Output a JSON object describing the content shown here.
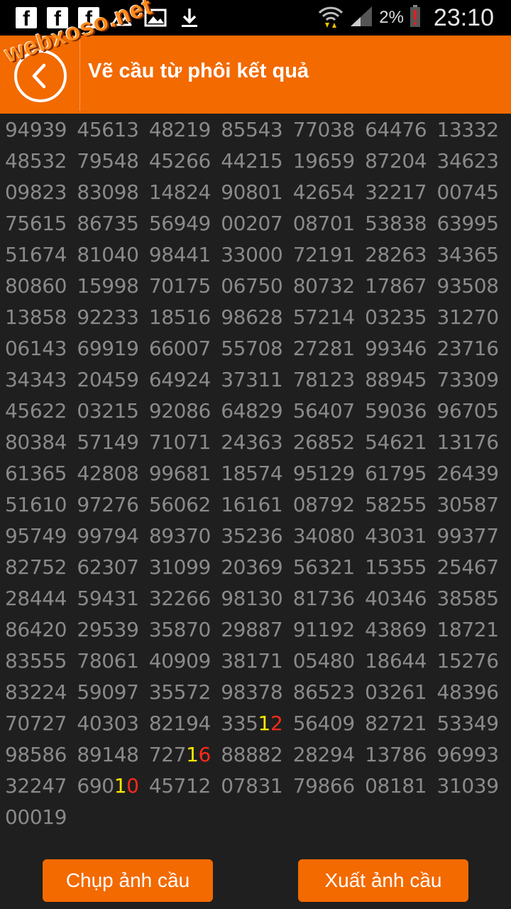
{
  "status_bar": {
    "facebook_glyph": "f",
    "battery_percent": "2%",
    "time": "23:10",
    "icons": [
      "facebook-icon",
      "facebook-icon",
      "facebook-icon",
      "mountain-icon",
      "image-icon",
      "download-icon",
      "wifi-icon",
      "signal-icon",
      "battery-alert-icon"
    ]
  },
  "watermark": "webxoso.net",
  "header": {
    "title": "Vẽ cầu từ phôi kết quả"
  },
  "colors": {
    "accent": "#f26a00",
    "highlight_yellow": "#ffea00",
    "highlight_red": "#ff2a1a",
    "number_gray": "#8a8a8a",
    "background": "#1f1f1f"
  },
  "grid": {
    "rows": [
      [
        "94939",
        "45613",
        "48219",
        "85543",
        "77038",
        "64476",
        "13332"
      ],
      [
        "48532",
        "79548",
        "45266",
        "44215",
        "19659",
        "87204",
        "34623"
      ],
      [
        "09823",
        "83098",
        "14824",
        "90801",
        "42654",
        "32217",
        "00745"
      ],
      [
        "75615",
        "86735",
        "56949",
        "00207",
        "08701",
        "53838",
        "63995"
      ],
      [
        "51674",
        "81040",
        "98441",
        "33000",
        "72191",
        "28263",
        "34365"
      ],
      [
        "80860",
        "15998",
        "70175",
        "06750",
        "80732",
        "17867",
        "93508"
      ],
      [
        "13858",
        "92233",
        "18516",
        "98628",
        "57214",
        "03235",
        "31270"
      ],
      [
        "06143",
        "69919",
        "66007",
        "55708",
        "27281",
        "99346",
        "23716"
      ],
      [
        "34343",
        "20459",
        "64924",
        "37311",
        "78123",
        "88945",
        "73309"
      ],
      [
        "45622",
        "03215",
        "92086",
        "64829",
        "56407",
        "59036",
        "96705"
      ],
      [
        "80384",
        "57149",
        "71071",
        "24363",
        "26852",
        "54621",
        "13176"
      ],
      [
        "61365",
        "42808",
        "99681",
        "18574",
        "95129",
        "61795",
        "26439"
      ],
      [
        "51610",
        "97276",
        "56062",
        "16161",
        "08792",
        "58255",
        "30587"
      ],
      [
        "95749",
        "99794",
        "89370",
        "35236",
        "34080",
        "43031",
        "99377"
      ],
      [
        "82752",
        "62307",
        "31099",
        "20369",
        "56321",
        "15355",
        "25467"
      ],
      [
        "28444",
        "59431",
        "32266",
        "98130",
        "81736",
        "40346",
        "38585"
      ],
      [
        "86420",
        "29539",
        "35870",
        "29887",
        "91192",
        "43869",
        "18721"
      ],
      [
        "83555",
        "78061",
        "40909",
        "38171",
        "05480",
        "18644",
        "15276"
      ],
      [
        "83224",
        "59097",
        "35572",
        "98378",
        "86523",
        "03261",
        "48396"
      ],
      [
        "70727",
        "40303",
        "82194",
        "33512",
        "56409",
        "82721",
        "53349"
      ],
      [
        "98586",
        "89148",
        "72716",
        "88882",
        "28294",
        "13786",
        "96993"
      ],
      [
        "32247",
        "69010",
        "45712",
        "07831",
        "79866",
        "08181",
        "31039"
      ],
      [
        "00019"
      ]
    ],
    "highlights": [
      {
        "row": 19,
        "col": 3,
        "digits": [
          {
            "pos": 3,
            "color": "yellow"
          },
          {
            "pos": 4,
            "color": "red"
          }
        ]
      },
      {
        "row": 20,
        "col": 2,
        "digits": [
          {
            "pos": 3,
            "color": "yellow"
          },
          {
            "pos": 4,
            "color": "red"
          }
        ]
      },
      {
        "row": 21,
        "col": 1,
        "digits": [
          {
            "pos": 3,
            "color": "yellow"
          },
          {
            "pos": 4,
            "color": "red"
          }
        ]
      }
    ]
  },
  "buttons": {
    "capture_label": "Chụp ảnh cầu",
    "export_label": "Xuất ảnh cầu"
  }
}
